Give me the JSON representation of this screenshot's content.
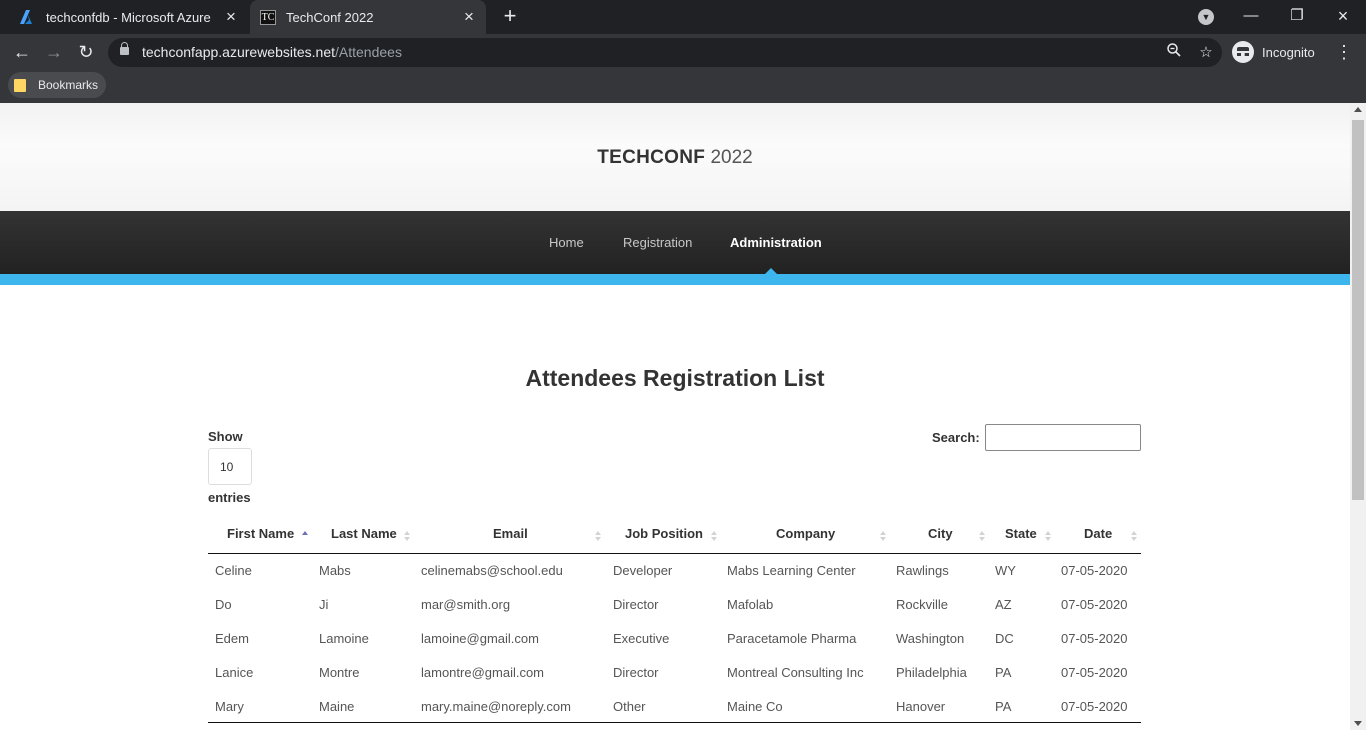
{
  "browser": {
    "tabs": [
      {
        "title": "techconfdb - Microsoft Azure",
        "favicon": "azure-icon",
        "active": false
      },
      {
        "title": "TechConf 2022",
        "favicon": "TC",
        "active": true
      }
    ],
    "url_host": "techconfapp.azurewebsites.net",
    "url_path": "/Attendees",
    "profile_label": "Incognito",
    "bookmarks_label": "Bookmarks"
  },
  "site": {
    "brand_bold": "TECHCONF",
    "brand_year": "2022",
    "nav": [
      {
        "label": "Home",
        "active": false
      },
      {
        "label": "Registration",
        "active": false
      },
      {
        "label": "Administration",
        "active": true
      }
    ],
    "accent_color": "#3cb6ec"
  },
  "page": {
    "title": "Attendees Registration List",
    "show_label": "Show",
    "page_length": "10",
    "entries_label": "entries",
    "search_label": "Search:",
    "search_value": ""
  },
  "table": {
    "columns": [
      "First Name",
      "Last Name",
      "Email",
      "Job Position",
      "Company",
      "City",
      "State",
      "Date"
    ],
    "sorted_column": "First Name",
    "sort_direction": "asc",
    "rows": [
      [
        "Celine",
        "Mabs",
        "celinemabs@school.edu",
        "Developer",
        "Mabs Learning Center",
        "Rawlings",
        "WY",
        "07-05-2020"
      ],
      [
        "Do",
        "Ji",
        "mar@smith.org",
        "Director",
        "Mafolab",
        "Rockville",
        "AZ",
        "07-05-2020"
      ],
      [
        "Edem",
        "Lamoine",
        "lamoine@gmail.com",
        "Executive",
        "Paracetamole Pharma",
        "Washington",
        "DC",
        "07-05-2020"
      ],
      [
        "Lanice",
        "Montre",
        "lamontre@gmail.com",
        "Director",
        "Montreal Consulting Inc",
        "Philadelphia",
        "PA",
        "07-05-2020"
      ],
      [
        "Mary",
        "Maine",
        "mary.maine@noreply.com",
        "Other",
        "Maine Co",
        "Hanover",
        "PA",
        "07-05-2020"
      ]
    ]
  }
}
